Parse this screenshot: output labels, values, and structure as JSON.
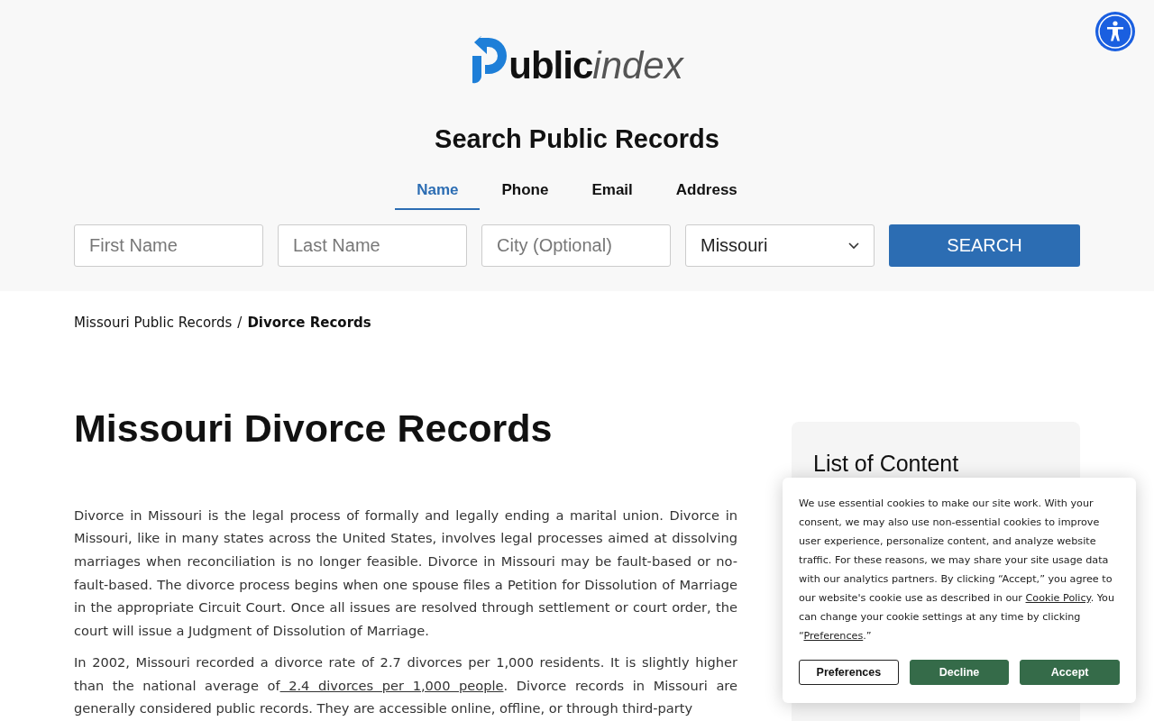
{
  "header": {
    "logo": {
      "bold": "ublic",
      "light": "index"
    },
    "title": "Search Public Records",
    "tabs": [
      {
        "label": "Name",
        "selected": true
      },
      {
        "label": "Phone",
        "selected": false
      },
      {
        "label": "Email",
        "selected": false
      },
      {
        "label": "Address",
        "selected": false
      }
    ],
    "fields": [
      {
        "placeholder": "First Name"
      },
      {
        "placeholder": "Last Name"
      },
      {
        "placeholder": "City (Optional)"
      }
    ],
    "state_select": {
      "value": "Missouri"
    },
    "search_button": "SEARCH"
  },
  "breadcrumb": {
    "items": [
      "Missouri Public Records"
    ],
    "separator": "/",
    "current": "Divorce Records"
  },
  "article": {
    "title": "Missouri Divorce Records",
    "paragraphs": [
      [
        {
          "text": "Divorce in Missouri is the legal process of formally and legally ending a marital union. Divorce in Missouri, like in many states across the United States, involves legal processes aimed at dissolving marriages when reconciliation is no longer feasible. Divorce in Missouri may be fault-based or no-fault-based. The divorce process begins when one spouse files a Petition for Dissolution of Marriage in the appropriate Circuit Court. Once all issues are resolved through settlement or court order, the court will issue a Judgment of Dissolution of Marriage.",
          "kind": "text"
        }
      ],
      [
        {
          "text": "In 2002, Missouri recorded a divorce rate of 2.7 divorces per 1,000 residents. It is slightly higher than the national average of",
          "kind": "text"
        },
        {
          "text": " 2.4 divorces per 1,000 people",
          "kind": "link"
        },
        {
          "text": ". Divorce records in Missouri are generally considered public records. They are accessible online, offline, or through third-party",
          "kind": "text"
        }
      ]
    ]
  },
  "sidebar": {
    "title": "List of Content"
  },
  "cookie_banner": {
    "text": [
      {
        "text": "We use essential cookies to make our site work. With your consent, we may also use non-essential cookies to improve user experience, personalize content, and analyze website traffic. For these reasons, we may share your site usage data with our analytics partners. By clicking “Accept,” you agree to our website's cookie use as described in our ",
        "kind": "text"
      },
      {
        "text": "Cookie Policy",
        "kind": "link"
      },
      {
        "text": ". You can change your cookie settings at any time by clicking “",
        "kind": "text"
      },
      {
        "text": "Preferences",
        "kind": "link"
      },
      {
        "text": ".”",
        "kind": "text"
      }
    ],
    "buttons": [
      {
        "label": "Preferences",
        "kind": "outline"
      },
      {
        "label": "Decline",
        "kind": "filled"
      },
      {
        "label": "Accept",
        "kind": "filled"
      }
    ]
  }
}
